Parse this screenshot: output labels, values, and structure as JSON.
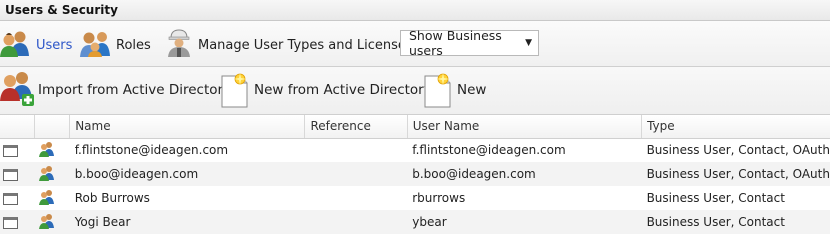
{
  "window": {
    "title": "Users & Security"
  },
  "nav": {
    "users_label": "Users",
    "roles_label": "Roles",
    "manage_label": "Manage User Types and Licenses",
    "filter": {
      "selected": "Show Business users"
    }
  },
  "toolbar": {
    "import_label": "Import from Active Directory",
    "new_ad_label": "New from Active Directory",
    "new_label": "New"
  },
  "table": {
    "columns": [
      "",
      "",
      "Name",
      "Reference",
      "User Name",
      "Type"
    ],
    "rows": [
      {
        "name": "f.flintstone@ideagen.com",
        "reference": "",
        "username": "f.flintstone@ideagen.com",
        "type": "Business User, Contact, OAuth"
      },
      {
        "name": "b.boo@ideagen.com",
        "reference": "",
        "username": "b.boo@ideagen.com",
        "type": "Business User, Contact, OAuth"
      },
      {
        "name": "Rob Burrows",
        "reference": "",
        "username": "rburrows",
        "type": "Business User, Contact"
      },
      {
        "name": "Yogi Bear",
        "reference": "",
        "username": "ybear",
        "type": "Business User, Contact"
      }
    ]
  },
  "colors": {
    "active_nav": "#2d56c8",
    "row_alt": "#f3f3f3"
  }
}
